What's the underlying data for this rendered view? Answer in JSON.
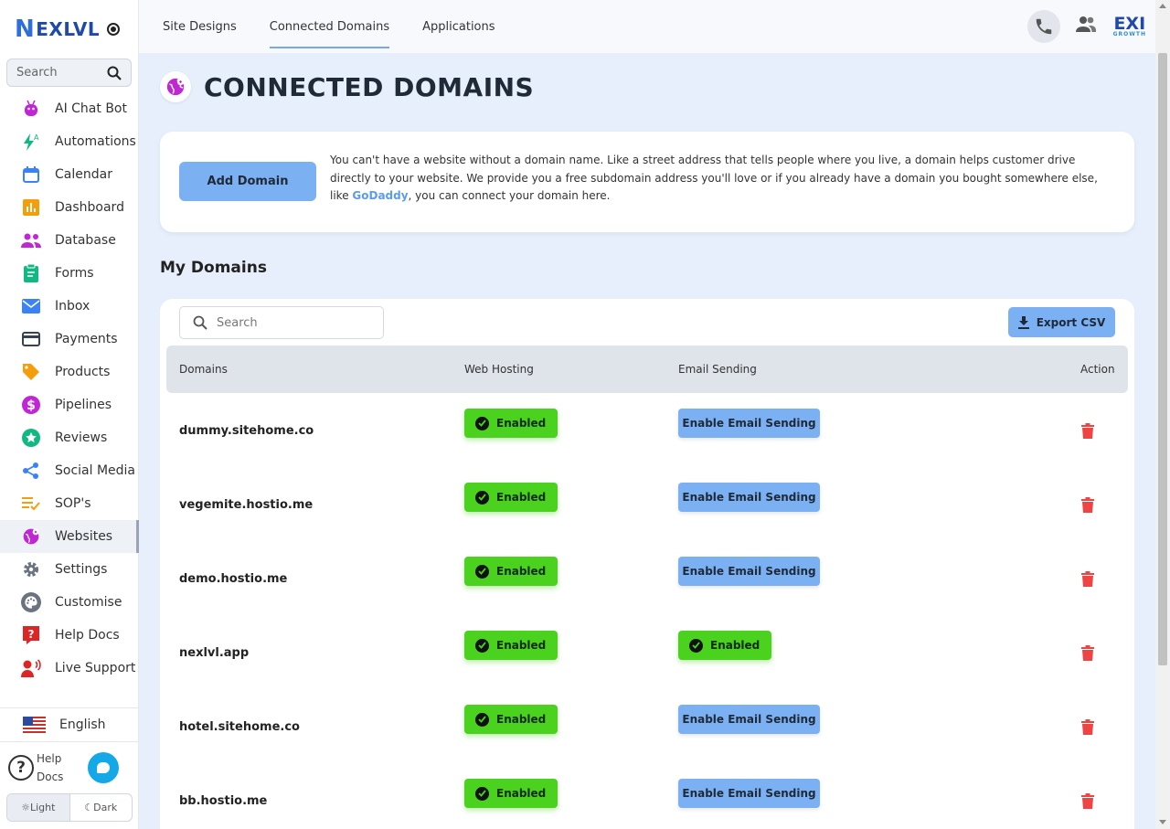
{
  "brand": {
    "logo_mark": "N",
    "logo_text": "EXLVL",
    "corner_logo": "EXI",
    "corner_logo_sub": "GROWTH"
  },
  "sidebar": {
    "search_placeholder": "Search",
    "items": [
      {
        "label": "AI Chat Bot",
        "icon": "robot-icon",
        "color": "#c026d3"
      },
      {
        "label": "Automations",
        "icon": "lightning-icon",
        "color": "#10b981"
      },
      {
        "label": "Calendar",
        "icon": "calendar-icon",
        "color": "#3b82f6"
      },
      {
        "label": "Dashboard",
        "icon": "bar-chart-icon",
        "color": "#f59e0b"
      },
      {
        "label": "Database",
        "icon": "people-icon",
        "color": "#c026d3"
      },
      {
        "label": "Forms",
        "icon": "clipboard-icon",
        "color": "#10b981"
      },
      {
        "label": "Inbox",
        "icon": "mail-icon",
        "color": "#3b82f6"
      },
      {
        "label": "Payments",
        "icon": "credit-card-icon",
        "color": "#374151"
      },
      {
        "label": "Products",
        "icon": "tag-icon",
        "color": "#f59e0b"
      },
      {
        "label": "Pipelines",
        "icon": "dollar-icon",
        "color": "#c026d3"
      },
      {
        "label": "Reviews",
        "icon": "star-icon",
        "color": "#10b981"
      },
      {
        "label": "Social Media",
        "icon": "share-icon",
        "color": "#3b82f6"
      },
      {
        "label": "SOP's",
        "icon": "checklist-icon",
        "color": "#f59e0b"
      },
      {
        "label": "Websites",
        "icon": "globe-icon",
        "color": "#c026d3",
        "active": true
      },
      {
        "label": "Settings",
        "icon": "gear-icon",
        "color": "#6b7280"
      },
      {
        "label": "Customise",
        "icon": "palette-icon",
        "color": "#6b7280"
      },
      {
        "label": "Help Docs",
        "icon": "help-icon",
        "color": "#dc2626"
      },
      {
        "label": "Live Support",
        "icon": "support-icon",
        "color": "#dc2626"
      }
    ],
    "language": "English",
    "help_label_1": "Help",
    "help_label_2": "Docs",
    "theme_light": "Light",
    "theme_dark": "Dark"
  },
  "topbar": {
    "tabs": [
      "Site Designs",
      "Connected Domains",
      "Applications"
    ],
    "active_tab": "Connected Domains"
  },
  "page": {
    "title": "CONNECTED DOMAINS",
    "add_button": "Add Domain",
    "intro_before_link": "You can't have a website without a domain name. Like a street address that tells people where you live, a domain helps customer drive directly to your website. We provide you a free subdomain address you'll love or if you already have a domain you bought somewhere else, like ",
    "intro_link": "GoDaddy",
    "intro_after_link": ", you can connect your domain here.",
    "section_title": "My Domains",
    "search_placeholder": "Search",
    "export_button": "Export CSV"
  },
  "table": {
    "columns": [
      "Domains",
      "Web Hosting",
      "Email Sending",
      "Action"
    ],
    "rows": [
      {
        "domain": "dummy.sitehome.co",
        "web_hosting": "Enabled",
        "email_sending": "Enable Email Sending",
        "email_enabled": false
      },
      {
        "domain": "vegemite.hostio.me",
        "web_hosting": "Enabled",
        "email_sending": "Enable Email Sending",
        "email_enabled": false
      },
      {
        "domain": "demo.hostio.me",
        "web_hosting": "Enabled",
        "email_sending": "Enable Email Sending",
        "email_enabled": false
      },
      {
        "domain": "nexlvl.app",
        "web_hosting": "Enabled",
        "email_sending": "Enabled",
        "email_enabled": true
      },
      {
        "domain": "hotel.sitehome.co",
        "web_hosting": "Enabled",
        "email_sending": "Enable Email Sending",
        "email_enabled": false
      },
      {
        "domain": "bb.hostio.me",
        "web_hosting": "Enabled",
        "email_sending": "Enable Email Sending",
        "email_enabled": false
      }
    ]
  },
  "colors": {
    "accent_blue": "#7bb1f3",
    "enabled_green": "#4ad21f",
    "delete_red": "#ef4444",
    "link": "#5a9de8"
  }
}
